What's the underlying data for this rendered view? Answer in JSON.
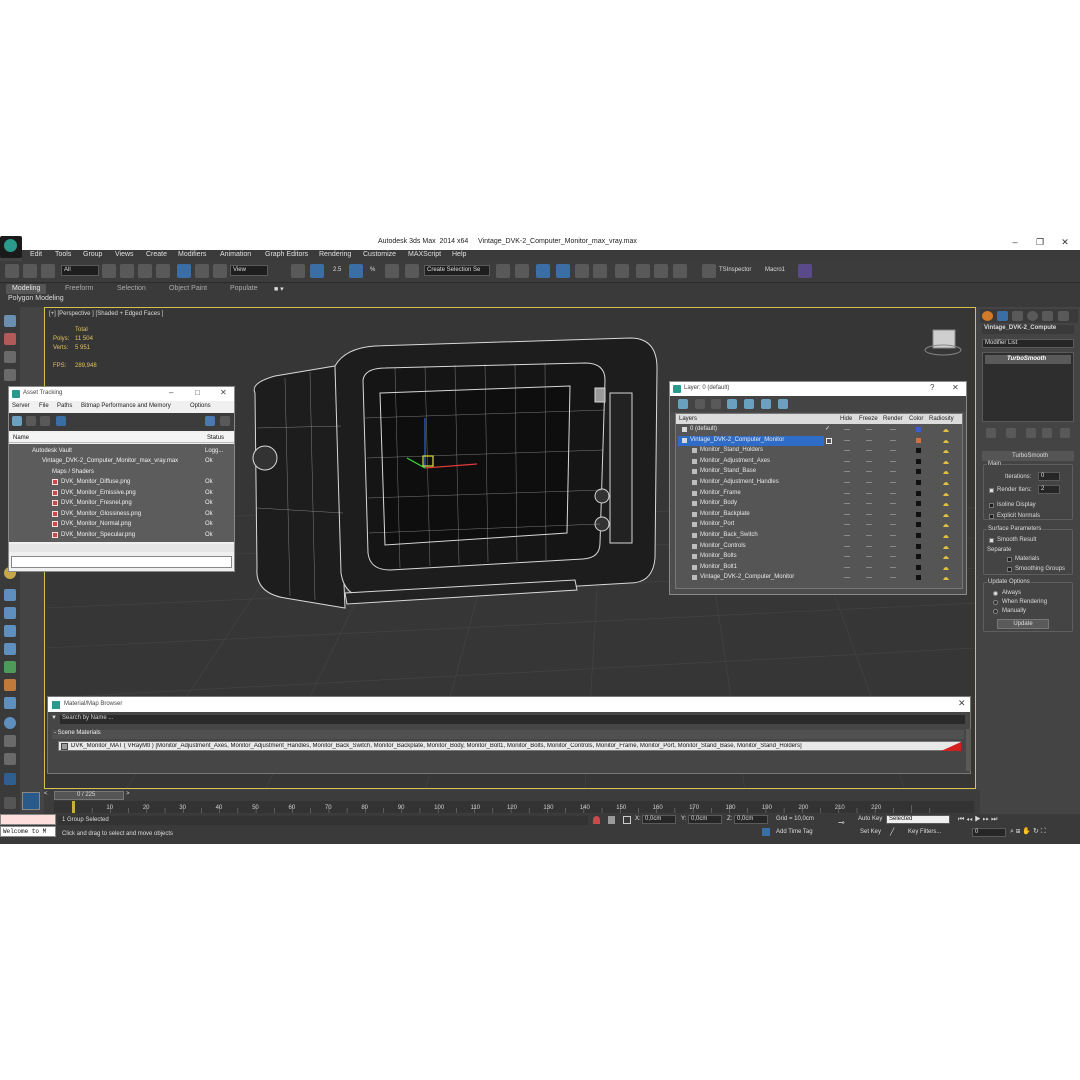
{
  "window": {
    "title": "Autodesk 3ds Max  2014 x64     Vintage_DVK-2_Computer_Monitor_max_vray.max",
    "minimize": "–",
    "maximize": "❐",
    "close": "✕"
  },
  "menu": [
    "Edit",
    "Tools",
    "Group",
    "Views",
    "Create",
    "Modifiers",
    "Animation",
    "Graph Editors",
    "Rendering",
    "Customize",
    "MAXScript",
    "Help"
  ],
  "toolbar": {
    "selection_filter": "All",
    "reference_coord": "View",
    "named_selection": "Create Selection Se",
    "angle_snap": "2.5",
    "percent_snap": "%",
    "tsinspector": "TSInspector",
    "macro1": "Macro1"
  },
  "ribbon": {
    "tabs": [
      "Modeling",
      "Freeform",
      "Selection",
      "Object Paint",
      "Populate"
    ],
    "sub_label": "Polygon Modeling"
  },
  "viewport": {
    "label": "[+] [Perspective ] [Shaded + Edged Faces ]",
    "stats": {
      "total_label": "Total",
      "polys_label": "Polys:",
      "polys_value": "11 504",
      "verts_label": "Verts:",
      "verts_value": "5 951",
      "fps_label": "FPS:",
      "fps_value": "289,948"
    }
  },
  "asset_tracking": {
    "title": "Asset Tracking",
    "menu": [
      "Server",
      "File",
      "Paths",
      "Bitmap Performance and Memory",
      "Options"
    ],
    "columns": {
      "name": "Name",
      "status": "Status"
    },
    "rows": [
      {
        "name": "Autodesk Vault",
        "status": "Logg..."
      },
      {
        "name": "Vintage_DVK-2_Computer_Monitor_max_vray.max",
        "status": "Ok"
      },
      {
        "name": "Maps / Shaders",
        "status": ""
      },
      {
        "name": "DVK_Monitor_Diffuse.png",
        "status": "Ok"
      },
      {
        "name": "DVK_Monitor_Emissive.png",
        "status": "Ok"
      },
      {
        "name": "DVK_Monitor_Fresnel.png",
        "status": "Ok"
      },
      {
        "name": "DVK_Monitor_Glossiness.png",
        "status": "Ok"
      },
      {
        "name": "DVK_Monitor_Normal.png",
        "status": "Ok"
      },
      {
        "name": "DVK_Monitor_Specular.png",
        "status": "Ok"
      }
    ]
  },
  "layer_dialog": {
    "title": "Layer: 0 (default)",
    "help": "?",
    "columns": [
      "Layers",
      "Hide",
      "Freeze",
      "Render",
      "Color",
      "Radiosity"
    ],
    "rows": [
      {
        "name": "0 (default)",
        "type": "layer"
      },
      {
        "name": "Vintage_DVK-2_Computer_Monitor",
        "type": "layer-selected"
      },
      {
        "name": "Monitor_Stand_Holders",
        "type": "object"
      },
      {
        "name": "Monitor_Adjustment_Axes",
        "type": "object"
      },
      {
        "name": "Monitor_Stand_Base",
        "type": "object"
      },
      {
        "name": "Monitor_Adjustment_Handles",
        "type": "object"
      },
      {
        "name": "Monitor_Frame",
        "type": "object"
      },
      {
        "name": "Monitor_Body",
        "type": "object"
      },
      {
        "name": "Monitor_Backplate",
        "type": "object"
      },
      {
        "name": "Monitor_Port",
        "type": "object"
      },
      {
        "name": "Monitor_Back_Switch",
        "type": "object"
      },
      {
        "name": "Monitor_Controls",
        "type": "object"
      },
      {
        "name": "Monitor_Bolts",
        "type": "object"
      },
      {
        "name": "Monitor_Bolt1",
        "type": "object"
      },
      {
        "name": "Vintage_DVK-2_Computer_Monitor",
        "type": "object"
      }
    ],
    "colors": {
      "default_layer": "#3a5fd0",
      "monitor_layer": "#d07040",
      "object": "#111111"
    }
  },
  "command_panel": {
    "object_name": "Vintage_DVK-2_Compute",
    "modifier_list": "Modifier List",
    "stack_item": "TurboSmooth",
    "rollout_title": "TurboSmooth",
    "main_label": "Main",
    "iterations_label": "Iterations:",
    "iterations_value": "0",
    "render_iters_label": "Render Iters:",
    "render_iters_value": "2",
    "isoline_label": "Isoline Display",
    "explicit_normals_label": "Explicit Normals",
    "surface_params_label": "Surface Parameters",
    "smooth_result_label": "Smooth Result",
    "separate_label": "Separate",
    "materials_label": "Materials",
    "smoothing_groups_label": "Smoothing Groups",
    "update_options_label": "Update Options",
    "always_label": "Always",
    "when_rendering_label": "When Rendering",
    "manually_label": "Manually",
    "update_button": "Update"
  },
  "material_browser": {
    "title": "Material/Map Browser",
    "search_placeholder": "Search by Name ...",
    "section": "- Scene Materials",
    "material_entry": "DVK_Monitor_MAT ( VRayMtl ) [Monitor_Adjustment_Axes, Monitor_Adjustment_Handles, Monitor_Back_Switch, Monitor_Backplate, Monitor_Body, Monitor_Bolt1, Monitor_Bolts, Monitor_Controls, Monitor_Frame, Monitor_Port, Monitor_Stand_Base, Monitor_Stand_Holders]"
  },
  "timeline": {
    "frame_counter": "0 / 225",
    "ticks": [
      "10",
      "20",
      "30",
      "40",
      "50",
      "60",
      "70",
      "80",
      "90",
      "100",
      "110",
      "120",
      "130",
      "140",
      "150",
      "160",
      "170",
      "180",
      "190",
      "200",
      "210",
      "220"
    ]
  },
  "status": {
    "maxscript_listener": "Welcome to M",
    "selection": "1 Group Selected",
    "prompt": "Click and drag to select and move objects",
    "x_label": "X:",
    "x_value": "0,0cm",
    "y_label": "Y:",
    "y_value": "0,0cm",
    "z_label": "Z:",
    "z_value": "0,0cm",
    "grid": "Grid = 10,0cm",
    "add_time_tag": "Add Time Tag",
    "auto_key": "Auto Key",
    "set_key": "Set Key",
    "key_mode": "Selected",
    "key_filters": "Key Filters...",
    "current_frame": "0"
  }
}
